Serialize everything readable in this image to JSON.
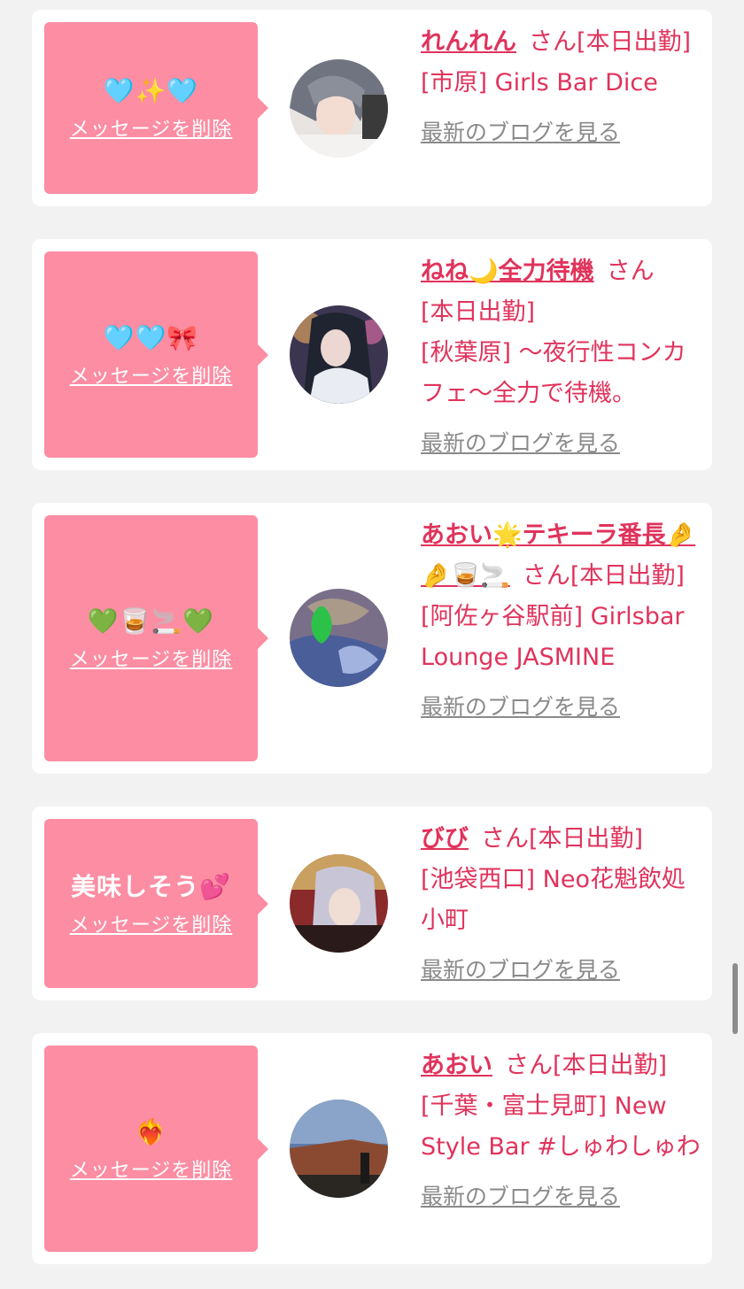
{
  "cards": [
    {
      "message": "🩵✨🩵",
      "delete_label": "メッセージを削除",
      "name": "れんれん",
      "san": "さん",
      "status": "[本日出勤]",
      "shop": "[市原] Girls Bar Dice",
      "blog_label": "最新のブログを見る"
    },
    {
      "message": "🩵🩵🎀",
      "delete_label": "メッセージを削除",
      "name": "ねね🌙全力待機",
      "san": "さん",
      "status": "[本日出勤]",
      "shop": "[秋葉原] 〜夜行性コンカフェ〜全力で待機。",
      "blog_label": "最新のブログを見る"
    },
    {
      "message": "💚🥃🚬💚",
      "delete_label": "メッセージを削除",
      "name": "あおい🌟テキーラ番長🤌🤌🥃🚬",
      "san": "さん",
      "status": "[本日出勤]",
      "shop": "[阿佐ヶ谷駅前] Girlsbar Lounge JASMINE",
      "blog_label": "最新のブログを見る"
    },
    {
      "message": "美味しそう💕",
      "delete_label": "メッセージを削除",
      "name": "びび",
      "san": "さん",
      "status": "[本日出勤]",
      "shop": "[池袋西口] Neo花魁飲処 小町",
      "blog_label": "最新のブログを見る"
    },
    {
      "message": "❤️‍🔥",
      "delete_label": "メッセージを削除",
      "name": "あおい",
      "san": "さん",
      "status": "[本日出勤]",
      "shop": "[千葉・富士見町] New Style Bar #しゅわしゅわ",
      "blog_label": "最新のブログを見る"
    }
  ],
  "colors": {
    "page_bg": "#f2f2f2",
    "card_bg": "#ffffff",
    "bubble_pink": "#fc8da3",
    "accent_text": "#e0335c",
    "link_gray": "#8a8a8a"
  },
  "icons": [
    "user-avatar",
    "scrollbar"
  ]
}
